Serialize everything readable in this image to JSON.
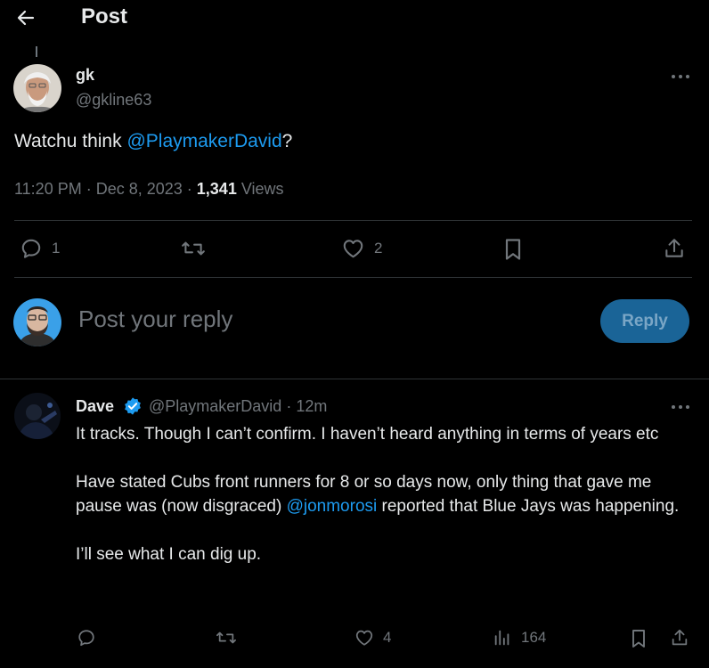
{
  "header": {
    "title": "Post"
  },
  "tweet": {
    "name": "gk",
    "handle": "@gkline63",
    "text_before": "Watchu think ",
    "mention": "@PlaymakerDavid",
    "text_after": "?",
    "time": "11:20 PM · Dec 8, 2023 · ",
    "views_count": "1,341",
    "views_label": " Views",
    "actions": {
      "replies": "1",
      "likes": "2"
    }
  },
  "composer": {
    "placeholder": "Post your reply",
    "button_label": "Reply"
  },
  "reply": {
    "name": "Dave",
    "handle": "@PlaymakerDavid",
    "time": " · 12m",
    "para1": "It tracks. Though I can’t confirm. I haven’t heard anything in terms of years etc",
    "para2_before": "Have stated Cubs front runners for 8 or so days now, only thing that gave me pause was (now disgraced) ",
    "para2_mention": "@jonmorosi",
    "para2_after": " reported that Blue Jays was happening.",
    "para3": "I’ll see what I can dig up.",
    "actions": {
      "likes": "4",
      "views": "164"
    }
  },
  "colors": {
    "accent": "#1d9bf0",
    "verified": "#1d9bf0",
    "muted": "#71767b",
    "reply_button": "#1a6497"
  },
  "icons": [
    "back-arrow-icon",
    "more-icon",
    "reply-icon",
    "retweet-icon",
    "like-icon",
    "bookmark-icon",
    "share-icon",
    "views-icon",
    "verified-badge-icon"
  ]
}
